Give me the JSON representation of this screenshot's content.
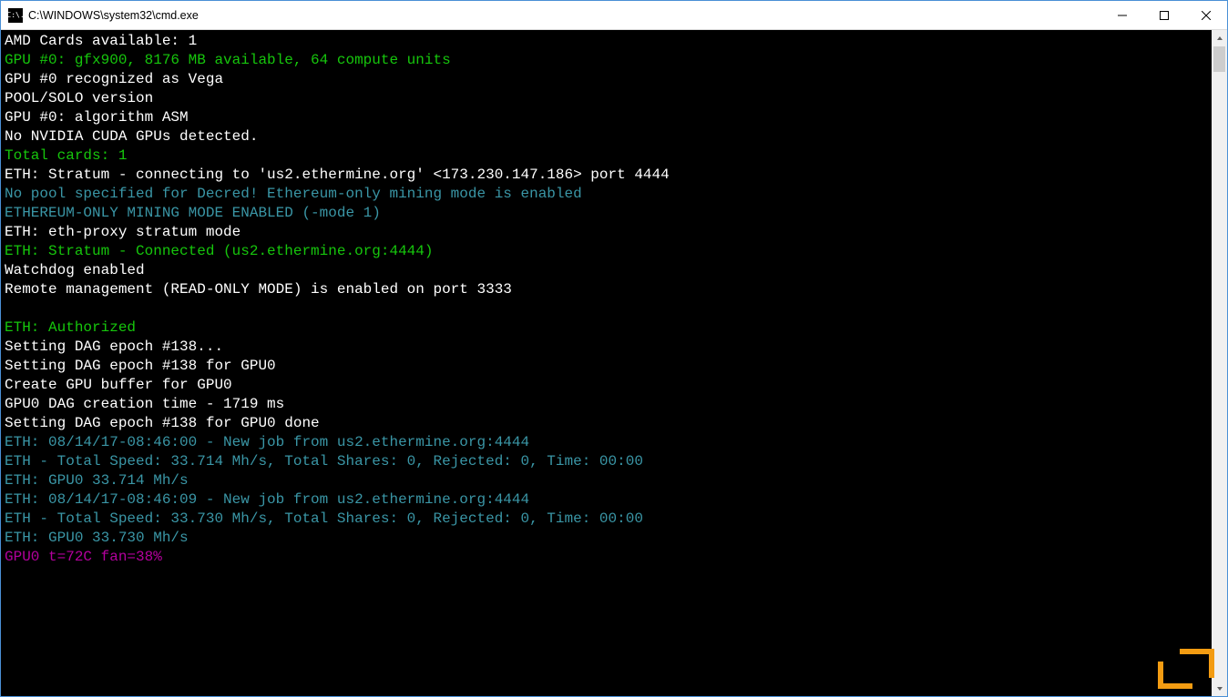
{
  "window": {
    "title": "C:\\WINDOWS\\system32\\cmd.exe",
    "icon_label": "C:\\."
  },
  "colors": {
    "green": "#16c60c",
    "cyan": "#3a96a6",
    "magenta": "#b4009e",
    "white": "#ffffff"
  },
  "lines": [
    {
      "text": "",
      "color": "white"
    },
    {
      "text": "AMD Cards available: 1",
      "color": "white"
    },
    {
      "text": "GPU #0: gfx900, 8176 MB available, 64 compute units",
      "color": "green"
    },
    {
      "text": "GPU #0 recognized as Vega",
      "color": "white"
    },
    {
      "text": "POOL/SOLO version",
      "color": "white"
    },
    {
      "text": "GPU #0: algorithm ASM",
      "color": "white"
    },
    {
      "text": "No NVIDIA CUDA GPUs detected.",
      "color": "white"
    },
    {
      "text": "Total cards: 1",
      "color": "green"
    },
    {
      "text": "ETH: Stratum - connecting to 'us2.ethermine.org' <173.230.147.186> port 4444",
      "color": "white"
    },
    {
      "text": "No pool specified for Decred! Ethereum-only mining mode is enabled",
      "color": "cyan"
    },
    {
      "text": "ETHEREUM-ONLY MINING MODE ENABLED (-mode 1)",
      "color": "cyan"
    },
    {
      "text": "ETH: eth-proxy stratum mode",
      "color": "white"
    },
    {
      "text": "ETH: Stratum - Connected (us2.ethermine.org:4444)",
      "color": "green"
    },
    {
      "text": "Watchdog enabled",
      "color": "white"
    },
    {
      "text": "Remote management (READ-ONLY MODE) is enabled on port 3333",
      "color": "white"
    },
    {
      "text": " ",
      "color": "white"
    },
    {
      "text": "ETH: Authorized",
      "color": "green"
    },
    {
      "text": "Setting DAG epoch #138...",
      "color": "white"
    },
    {
      "text": "Setting DAG epoch #138 for GPU0",
      "color": "white"
    },
    {
      "text": "Create GPU buffer for GPU0",
      "color": "white"
    },
    {
      "text": "GPU0 DAG creation time - 1719 ms",
      "color": "white"
    },
    {
      "text": "Setting DAG epoch #138 for GPU0 done",
      "color": "white"
    },
    {
      "text": "ETH: 08/14/17-08:46:00 - New job from us2.ethermine.org:4444",
      "color": "cyan"
    },
    {
      "text": "ETH - Total Speed: 33.714 Mh/s, Total Shares: 0, Rejected: 0, Time: 00:00",
      "color": "cyan"
    },
    {
      "text": "ETH: GPU0 33.714 Mh/s",
      "color": "cyan"
    },
    {
      "text": "ETH: 08/14/17-08:46:09 - New job from us2.ethermine.org:4444",
      "color": "cyan"
    },
    {
      "text": "ETH - Total Speed: 33.730 Mh/s, Total Shares: 0, Rejected: 0, Time: 00:00",
      "color": "cyan"
    },
    {
      "text": "ETH: GPU0 33.730 Mh/s",
      "color": "cyan"
    },
    {
      "text": "GPU0 t=72C fan=38%",
      "color": "magenta"
    }
  ]
}
